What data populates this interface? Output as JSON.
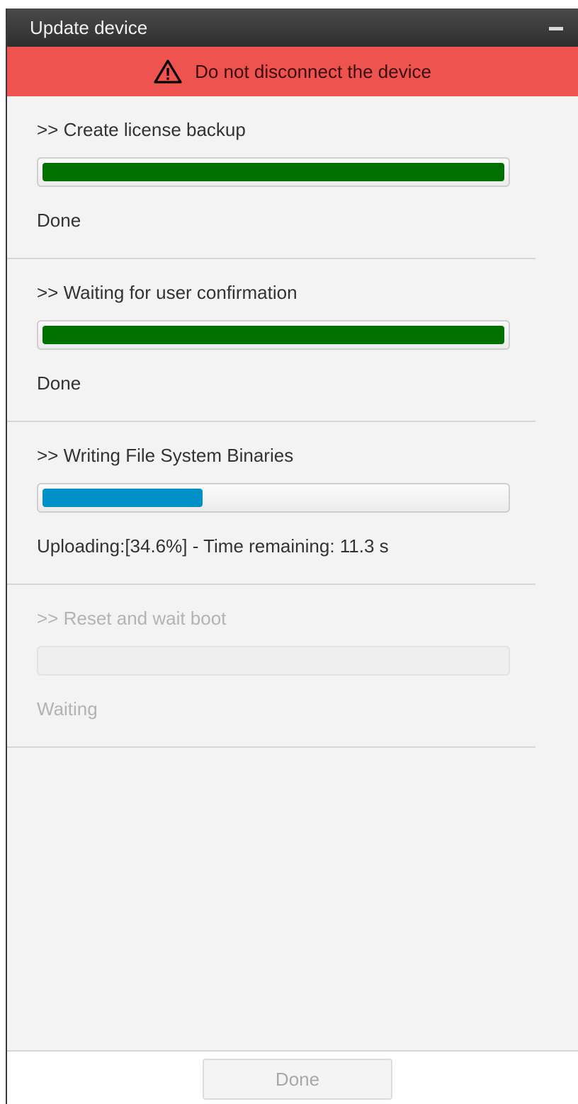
{
  "window": {
    "title": "Update device"
  },
  "warning": {
    "text": "Do not disconnect the device",
    "icon": "warning-triangle-icon"
  },
  "steps": [
    {
      "title": ">> Create license backup",
      "status": "Done",
      "progress_percent": 100,
      "color": "#007000",
      "enabled": true
    },
    {
      "title": ">> Waiting for user confirmation",
      "status": "Done",
      "progress_percent": 100,
      "color": "#007000",
      "enabled": true
    },
    {
      "title": ">> Writing File System Binaries",
      "status": "Uploading:[34.6%] - Time remaining: 11.3 s",
      "progress_percent": 34.6,
      "color": "#0090c8",
      "enabled": true
    },
    {
      "title": ">> Reset and wait boot",
      "status": "Waiting",
      "progress_percent": 0,
      "color": "#cccccc",
      "enabled": false
    }
  ],
  "footer": {
    "done_label": "Done"
  }
}
